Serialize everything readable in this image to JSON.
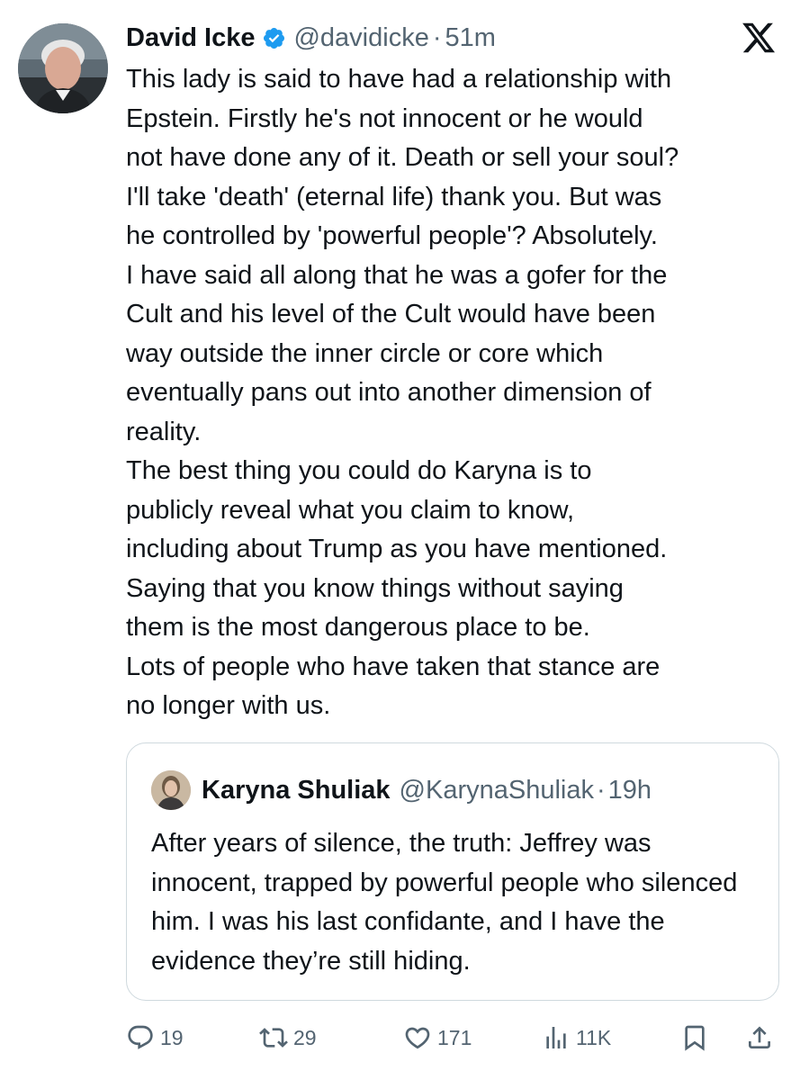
{
  "author": {
    "name": "David Icke",
    "handle": "@davidicke",
    "separator": "·",
    "time": "51m",
    "verified_badge_icon": "verified-badge-icon",
    "avatar_icon": "profile-photo"
  },
  "platform_logo": "x-logo-icon",
  "tweet_text": "This lady is said to have had a relationship with\nEpstein. Firstly he's not innocent or he would\nnot have done any of it. Death or sell your soul?\nI'll take 'death' (eternal life) thank you. But was\nhe controlled by 'powerful people'? Absolutely.\nI have said all along that he was a gofer for the\nCult and his level of the Cult would have been\nway outside the inner circle or core which\neventually pans out into another dimension of\nreality.\nThe best thing you could do Karyna is to\npublicly reveal what you claim to know,\nincluding about Trump as you have mentioned.\nSaying that you know things without saying\nthem is the most dangerous place to be.\nLots of people who have taken that stance are\nno longer with us.",
  "quoted_tweet": {
    "name": "Karyna Shuliak",
    "handle": "@KarynaShuliak",
    "separator": "·",
    "time": "19h",
    "text": "After years of silence, the truth: Jeffrey was innocent, trapped by powerful people who silenced him. I was his last confidante, and I have the evidence they’re still hiding."
  },
  "actions": {
    "replies": "19",
    "reposts": "29",
    "likes": "171",
    "views": "11K"
  },
  "colors": {
    "text": "#0f1419",
    "secondary": "#536471",
    "verified": "#1d9bf0",
    "border": "#cfd9de"
  }
}
